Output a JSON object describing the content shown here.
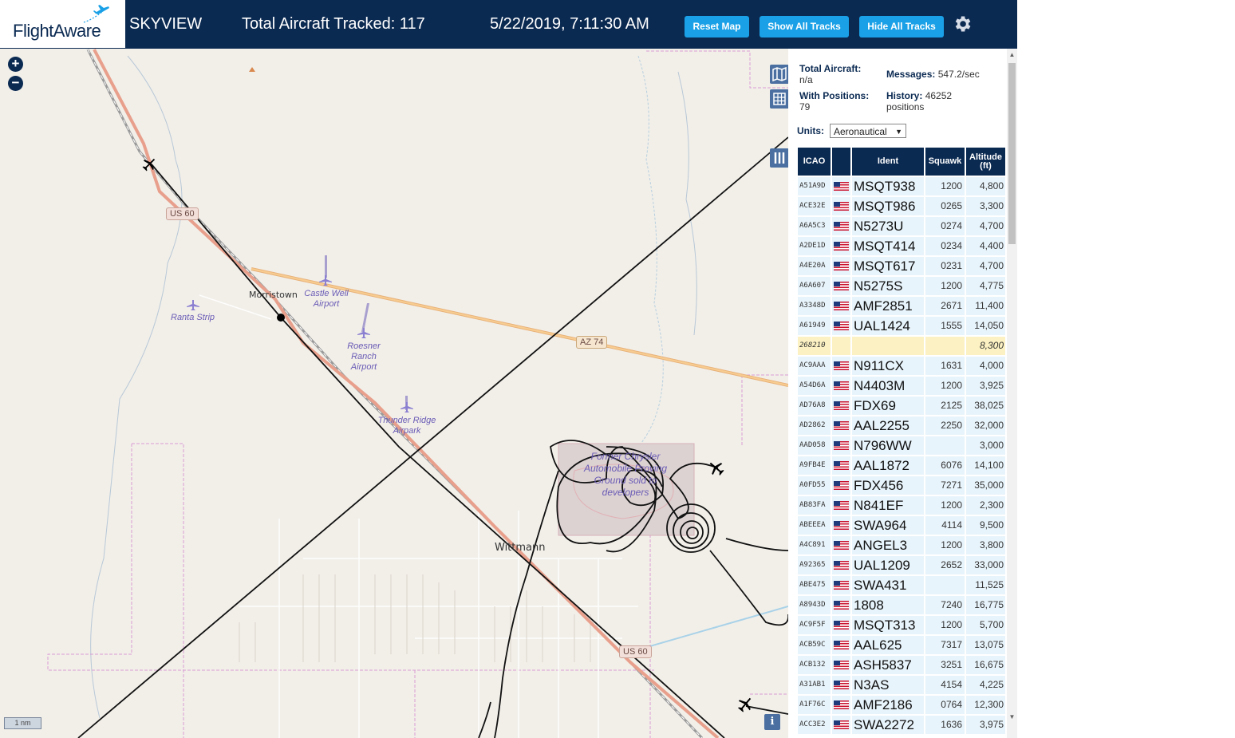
{
  "header": {
    "logo_text": "FlightAware",
    "app_name": "SKYVIEW",
    "total_tracked_label": "Total Aircraft Tracked: 117",
    "datetime": "5/22/2019, 7:11:30 AM",
    "buttons": {
      "reset_map": "Reset Map",
      "show_all_tracks": "Show All Tracks",
      "hide_all_tracks": "Hide All Tracks"
    },
    "settings_icon": "gear-icon"
  },
  "map": {
    "zoom_in": "+",
    "zoom_out": "−",
    "places": {
      "morristown": "Morristown",
      "wittmann": "Wittmann"
    },
    "airports": {
      "castle_well": "Castle Well Airport",
      "ranta": "Ranta Strip",
      "roesner": "Roesner Ranch Airport",
      "thunder_ridge": "Thunder Ridge Airpark"
    },
    "area_label": "Former Chrysler Automobile Proving Ground sold to developers",
    "roads": {
      "us60_a": "US 60",
      "us60_b": "US 60",
      "az74": "AZ 74"
    },
    "scale": "1 nm",
    "info": "i",
    "controls": [
      "map-icon",
      "grid-icon",
      "columns-icon"
    ]
  },
  "panel": {
    "stats": {
      "total_aircraft_label": "Total Aircraft:",
      "total_aircraft_value": "n/a",
      "messages_label": "Messages:",
      "messages_value": "547.2/sec",
      "with_positions_label": "With Positions:",
      "with_positions_value": "79",
      "history_label": "History:",
      "history_value": "46252 positions"
    },
    "units_label": "Units:",
    "units_value": "Aeronautical",
    "columns": {
      "icao": "ICAO",
      "ident": "Ident",
      "squawk": "Squawk",
      "altitude": "Altitude (ft)"
    },
    "rows": [
      {
        "icao": "A51A9D",
        "flag": true,
        "ident": "MSQT938",
        "squawk": "1200",
        "alt": "4,800"
      },
      {
        "icao": "ACE32E",
        "flag": true,
        "ident": "MSQT986",
        "squawk": "0265",
        "alt": "3,300"
      },
      {
        "icao": "A6A5C3",
        "flag": true,
        "ident": "N5273U",
        "squawk": "0274",
        "alt": "4,700"
      },
      {
        "icao": "A2DE1D",
        "flag": true,
        "ident": "MSQT414",
        "squawk": "0234",
        "alt": "4,400"
      },
      {
        "icao": "A4E20A",
        "flag": true,
        "ident": "MSQT617",
        "squawk": "0231",
        "alt": "4,700"
      },
      {
        "icao": "A6A607",
        "flag": true,
        "ident": "N5275S",
        "squawk": "1200",
        "alt": "4,775"
      },
      {
        "icao": "A3348D",
        "flag": true,
        "ident": "AMF2851",
        "squawk": "2671",
        "alt": "11,400"
      },
      {
        "icao": "A61949",
        "flag": true,
        "ident": "UAL1424",
        "squawk": "1555",
        "alt": "14,050"
      },
      {
        "icao": "268210",
        "flag": false,
        "ident": "",
        "squawk": "",
        "alt": "8,300",
        "highlight": true
      },
      {
        "icao": "AC9AAA",
        "flag": true,
        "ident": "N911CX",
        "squawk": "1631",
        "alt": "4,000"
      },
      {
        "icao": "A54D6A",
        "flag": true,
        "ident": "N4403M",
        "squawk": "1200",
        "alt": "3,925"
      },
      {
        "icao": "AD76A8",
        "flag": true,
        "ident": "FDX69",
        "squawk": "2125",
        "alt": "38,025"
      },
      {
        "icao": "AD2862",
        "flag": true,
        "ident": "AAL2255",
        "squawk": "2250",
        "alt": "32,000"
      },
      {
        "icao": "AAD058",
        "flag": true,
        "ident": "N796WW",
        "squawk": "",
        "alt": "3,000"
      },
      {
        "icao": "A9FB4E",
        "flag": true,
        "ident": "AAL1872",
        "squawk": "6076",
        "alt": "14,100"
      },
      {
        "icao": "A0FD55",
        "flag": true,
        "ident": "FDX456",
        "squawk": "7271",
        "alt": "35,000"
      },
      {
        "icao": "AB83FA",
        "flag": true,
        "ident": "N841EF",
        "squawk": "1200",
        "alt": "2,300"
      },
      {
        "icao": "ABEEEA",
        "flag": true,
        "ident": "SWA964",
        "squawk": "4114",
        "alt": "9,500"
      },
      {
        "icao": "A4C891",
        "flag": true,
        "ident": "ANGEL3",
        "squawk": "1200",
        "alt": "3,800"
      },
      {
        "icao": "A92365",
        "flag": true,
        "ident": "UAL1209",
        "squawk": "2652",
        "alt": "33,000"
      },
      {
        "icao": "ABE475",
        "flag": true,
        "ident": "SWA431",
        "squawk": "",
        "alt": "11,525"
      },
      {
        "icao": "A8943D",
        "flag": true,
        "ident": "1808",
        "squawk": "7240",
        "alt": "16,775"
      },
      {
        "icao": "AC9F5F",
        "flag": true,
        "ident": "MSQT313",
        "squawk": "1200",
        "alt": "5,700"
      },
      {
        "icao": "ACB59C",
        "flag": true,
        "ident": "AAL625",
        "squawk": "7317",
        "alt": "13,075"
      },
      {
        "icao": "ACB132",
        "flag": true,
        "ident": "ASH5837",
        "squawk": "3251",
        "alt": "16,675"
      },
      {
        "icao": "A31AB1",
        "flag": true,
        "ident": "N3AS",
        "squawk": "4154",
        "alt": "4,225"
      },
      {
        "icao": "A1F76C",
        "flag": true,
        "ident": "AMF2186",
        "squawk": "0764",
        "alt": "12,300"
      },
      {
        "icao": "ACC3E2",
        "flag": true,
        "ident": "SWA2272",
        "squawk": "1636",
        "alt": "3,975"
      }
    ]
  },
  "colors": {
    "header_bg": "#0b2a52",
    "button_bg": "#1aa0e6",
    "row_bg": "#e8f4fb",
    "row_highlight": "#fbf1c2",
    "map_bg": "#f2efe9"
  }
}
